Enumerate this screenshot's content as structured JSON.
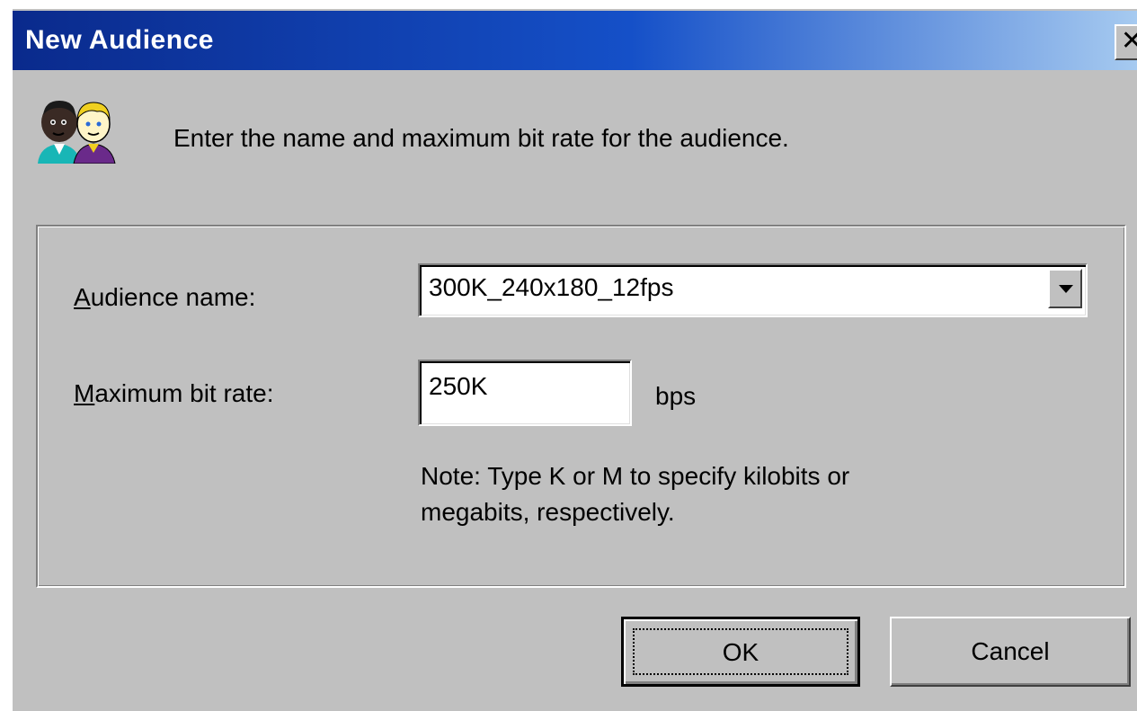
{
  "window": {
    "title": "New Audience",
    "close_glyph": "✕"
  },
  "header": {
    "icon": "audience-people-icon",
    "instruction": "Enter the name and maximum bit rate for the audience."
  },
  "form": {
    "audience_name": {
      "label_mnemonic": "A",
      "label_rest": "udience name:",
      "value": "300K_240x180_12fps"
    },
    "max_bit_rate": {
      "label_mnemonic": "M",
      "label_rest": "aximum bit rate:",
      "value": "250K",
      "unit": "bps"
    },
    "note_line1": "Note: Type K or M to specify kilobits or",
    "note_line2": "megabits, respectively."
  },
  "buttons": {
    "ok": "OK",
    "cancel": "Cancel"
  },
  "colors": {
    "title_gradient_start": "#0a2a8c",
    "title_gradient_end": "#a6caf0",
    "dialog_face": "#c0c0c0"
  }
}
